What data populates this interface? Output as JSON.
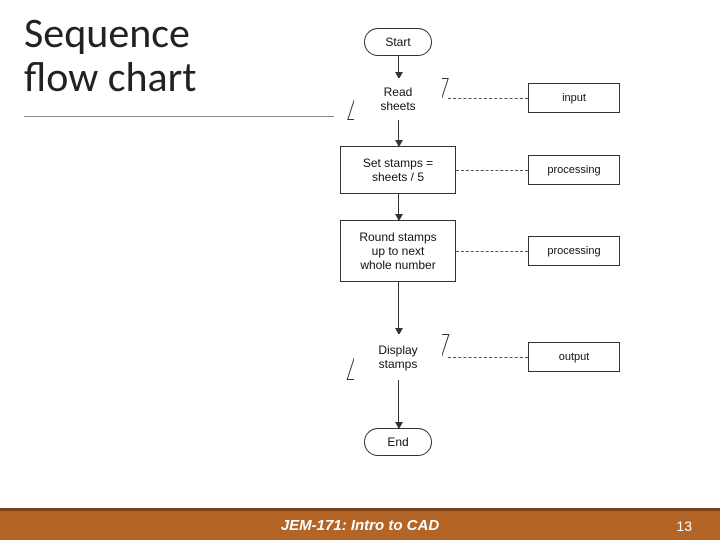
{
  "title": {
    "line1": "Sequence",
    "line2": "flow chart"
  },
  "flow": {
    "start": "Start",
    "read": "Read\nsheets",
    "calc": "Set stamps =\nsheets / 5",
    "round": "Round stamps\nup to next\nwhole number",
    "display": "Display\nstamps",
    "end": "End"
  },
  "annotations": {
    "input": "input",
    "proc1": "processing",
    "proc2": "processing",
    "output": "output"
  },
  "footer": {
    "course": "JEM-171: Intro to CAD",
    "page": "13"
  }
}
